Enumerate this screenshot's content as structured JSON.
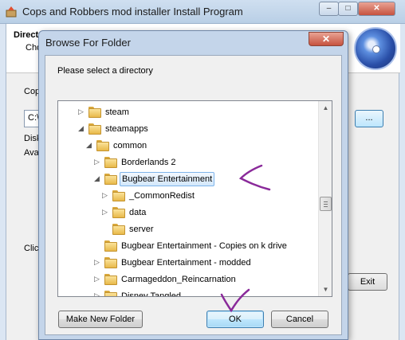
{
  "background_window": {
    "title": "Cops and Robbers mod installer Install Program",
    "header_title": "Directo",
    "header_subtitle": "Cho",
    "copy_label": "Cop",
    "path_value": "C:\\",
    "disk_label": "Disk",
    "available_label": "Ava",
    "click_label": "Click",
    "browse_label": "...",
    "exit_label": "Exit",
    "controls": {
      "minimize": "–",
      "maximize": "□",
      "close": "✕"
    }
  },
  "dialog": {
    "title": "Browse For Folder",
    "close_label": "✕",
    "prompt": "Please select a directory",
    "tree": [
      {
        "label": "steam",
        "indent": 0,
        "expanded": false,
        "has_children": true,
        "selected": false
      },
      {
        "label": "steamapps",
        "indent": 0,
        "expanded": true,
        "has_children": true,
        "selected": false
      },
      {
        "label": "common",
        "indent": 1,
        "expanded": true,
        "has_children": true,
        "selected": false
      },
      {
        "label": "Borderlands 2",
        "indent": 2,
        "expanded": false,
        "has_children": true,
        "selected": false
      },
      {
        "label": "Bugbear Entertainment",
        "indent": 2,
        "expanded": true,
        "has_children": true,
        "selected": true
      },
      {
        "label": "_CommonRedist",
        "indent": 3,
        "expanded": false,
        "has_children": true,
        "selected": false
      },
      {
        "label": "data",
        "indent": 3,
        "expanded": false,
        "has_children": true,
        "selected": false
      },
      {
        "label": "server",
        "indent": 3,
        "expanded": false,
        "has_children": false,
        "selected": false
      },
      {
        "label": "Bugbear Entertainment - Copies on k drive",
        "indent": 2,
        "expanded": false,
        "has_children": false,
        "selected": false
      },
      {
        "label": "Bugbear Entertainment - modded",
        "indent": 2,
        "expanded": false,
        "has_children": true,
        "selected": false
      },
      {
        "label": "Carmageddon_Reincarnation",
        "indent": 2,
        "expanded": false,
        "has_children": true,
        "selected": false
      },
      {
        "label": "Disney Tangled",
        "indent": 2,
        "expanded": false,
        "has_children": true,
        "selected": false
      }
    ],
    "buttons": {
      "new_folder": "Make New Folder",
      "ok": "OK",
      "cancel": "Cancel"
    }
  },
  "icons": {
    "app": "installer-icon",
    "disc": "disc-icon",
    "folder": "folder-icon",
    "expand": "expand-arrow-icon",
    "collapse": "collapse-arrow-icon"
  },
  "colors": {
    "selection_border": "#7eb4ea",
    "annotation_ink": "#8a2a9a",
    "ok_button": "#bee6fd"
  }
}
